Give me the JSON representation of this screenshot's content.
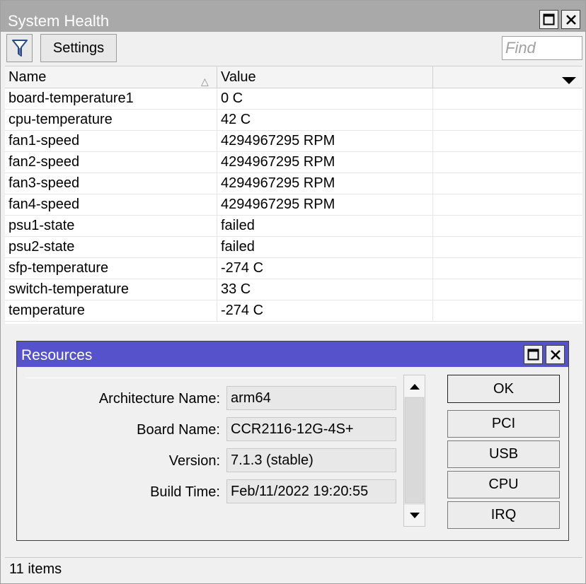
{
  "window": {
    "title": "System Health"
  },
  "toolbar": {
    "filter_icon": "funnel-icon",
    "settings_label": "Settings",
    "find_placeholder": "Find"
  },
  "table": {
    "columns": [
      "Name",
      "Value"
    ],
    "rows": [
      {
        "name": "board-temperature1",
        "value": "0 C"
      },
      {
        "name": "cpu-temperature",
        "value": "42 C"
      },
      {
        "name": "fan1-speed",
        "value": "4294967295 RPM"
      },
      {
        "name": "fan2-speed",
        "value": "4294967295 RPM"
      },
      {
        "name": "fan3-speed",
        "value": "4294967295 RPM"
      },
      {
        "name": "fan4-speed",
        "value": "4294967295 RPM"
      },
      {
        "name": "psu1-state",
        "value": "failed"
      },
      {
        "name": "psu2-state",
        "value": "failed"
      },
      {
        "name": "sfp-temperature",
        "value": "-274 C"
      },
      {
        "name": "switch-temperature",
        "value": "33 C"
      },
      {
        "name": "temperature",
        "value": "-274 C"
      }
    ]
  },
  "status": {
    "item_count": "11 items"
  },
  "resources": {
    "title": "Resources",
    "fields": [
      {
        "label": "Architecture Name:",
        "value": "arm64"
      },
      {
        "label": "Board Name:",
        "value": "CCR2116-12G-4S+"
      },
      {
        "label": "Version:",
        "value": "7.1.3 (stable)"
      },
      {
        "label": "Build Time:",
        "value": "Feb/11/2022 19:20:55"
      }
    ],
    "buttons": {
      "ok": "OK",
      "pci": "PCI",
      "usb": "USB",
      "cpu": "CPU",
      "irq": "IRQ"
    }
  },
  "colors": {
    "titlebar_inactive": "#a9a9a9",
    "titlebar_active": "#5552cc"
  }
}
